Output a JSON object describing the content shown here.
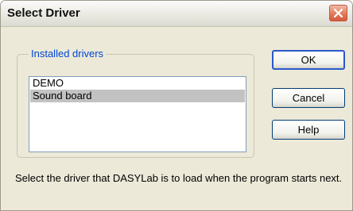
{
  "window": {
    "title": "Select Driver"
  },
  "group": {
    "label": "Installed drivers"
  },
  "drivers": {
    "items": [
      {
        "label": "DEMO",
        "selected": false
      },
      {
        "label": "Sound board",
        "selected": true
      }
    ]
  },
  "buttons": {
    "ok": "OK",
    "cancel": "Cancel",
    "help": "Help"
  },
  "footer": {
    "description": "Select the driver that DASYLab is to load when the program starts next."
  },
  "colors": {
    "group_label": "#0046d5",
    "selection": "#c2c2c2",
    "close_button": "#e27a5b",
    "dialog_bg": "#ece9d8"
  }
}
